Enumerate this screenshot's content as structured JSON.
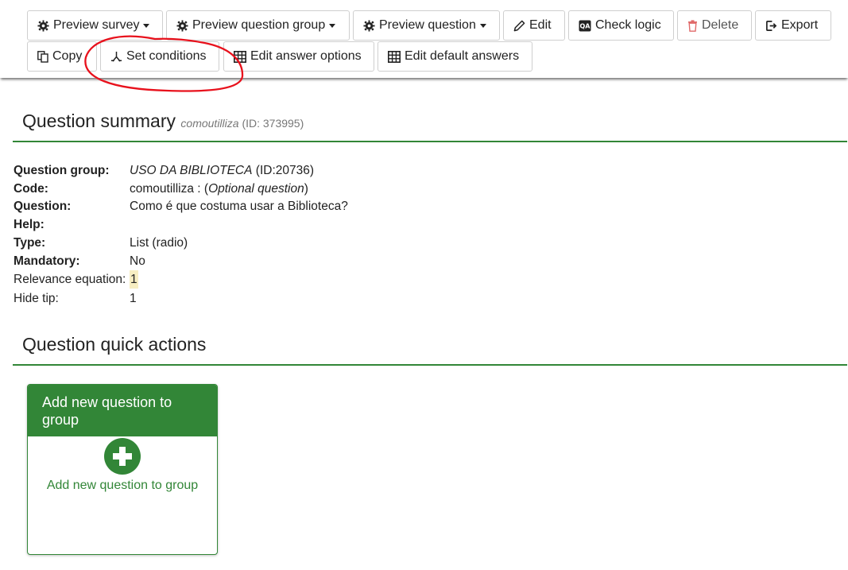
{
  "toolbar": {
    "preview_survey": "Preview survey",
    "preview_group": "Preview question group",
    "preview_question": "Preview question",
    "edit": "Edit",
    "check_logic": "Check logic",
    "delete": "Delete",
    "export": "Export",
    "copy": "Copy",
    "set_conditions": "Set conditions",
    "edit_answer_options": "Edit answer options",
    "edit_default_answers": "Edit default answers"
  },
  "annotation_color": "#e8111c",
  "summary": {
    "title": "Question summary",
    "code_name": "comoutilliza",
    "id_text": "(ID: 373995)",
    "rows": {
      "group_label": "Question group:",
      "group_name": "USO DA BIBLIOTECA",
      "group_id": "(ID:20736)",
      "code_label": "Code:",
      "code_value": "comoutilliza : (",
      "code_optional": "Optional question",
      "code_close": ")",
      "question_label": "Question:",
      "question_value": "Como é que costuma usar a Biblioteca?",
      "help_label": "Help:",
      "type_label": "Type:",
      "type_value": "List (radio)",
      "mandatory_label": "Mandatory:",
      "mandatory_value": "No",
      "relevance_label": "Relevance equation:",
      "relevance_value": "1",
      "hidetip_label": "Hide tip:",
      "hidetip_value": "1"
    }
  },
  "quick_actions": {
    "title": "Question quick actions",
    "card_title": "Add new question to group",
    "card_link": "Add new question to group"
  },
  "colors": {
    "accent_green": "#328637",
    "highlight": "#f7eec2"
  }
}
